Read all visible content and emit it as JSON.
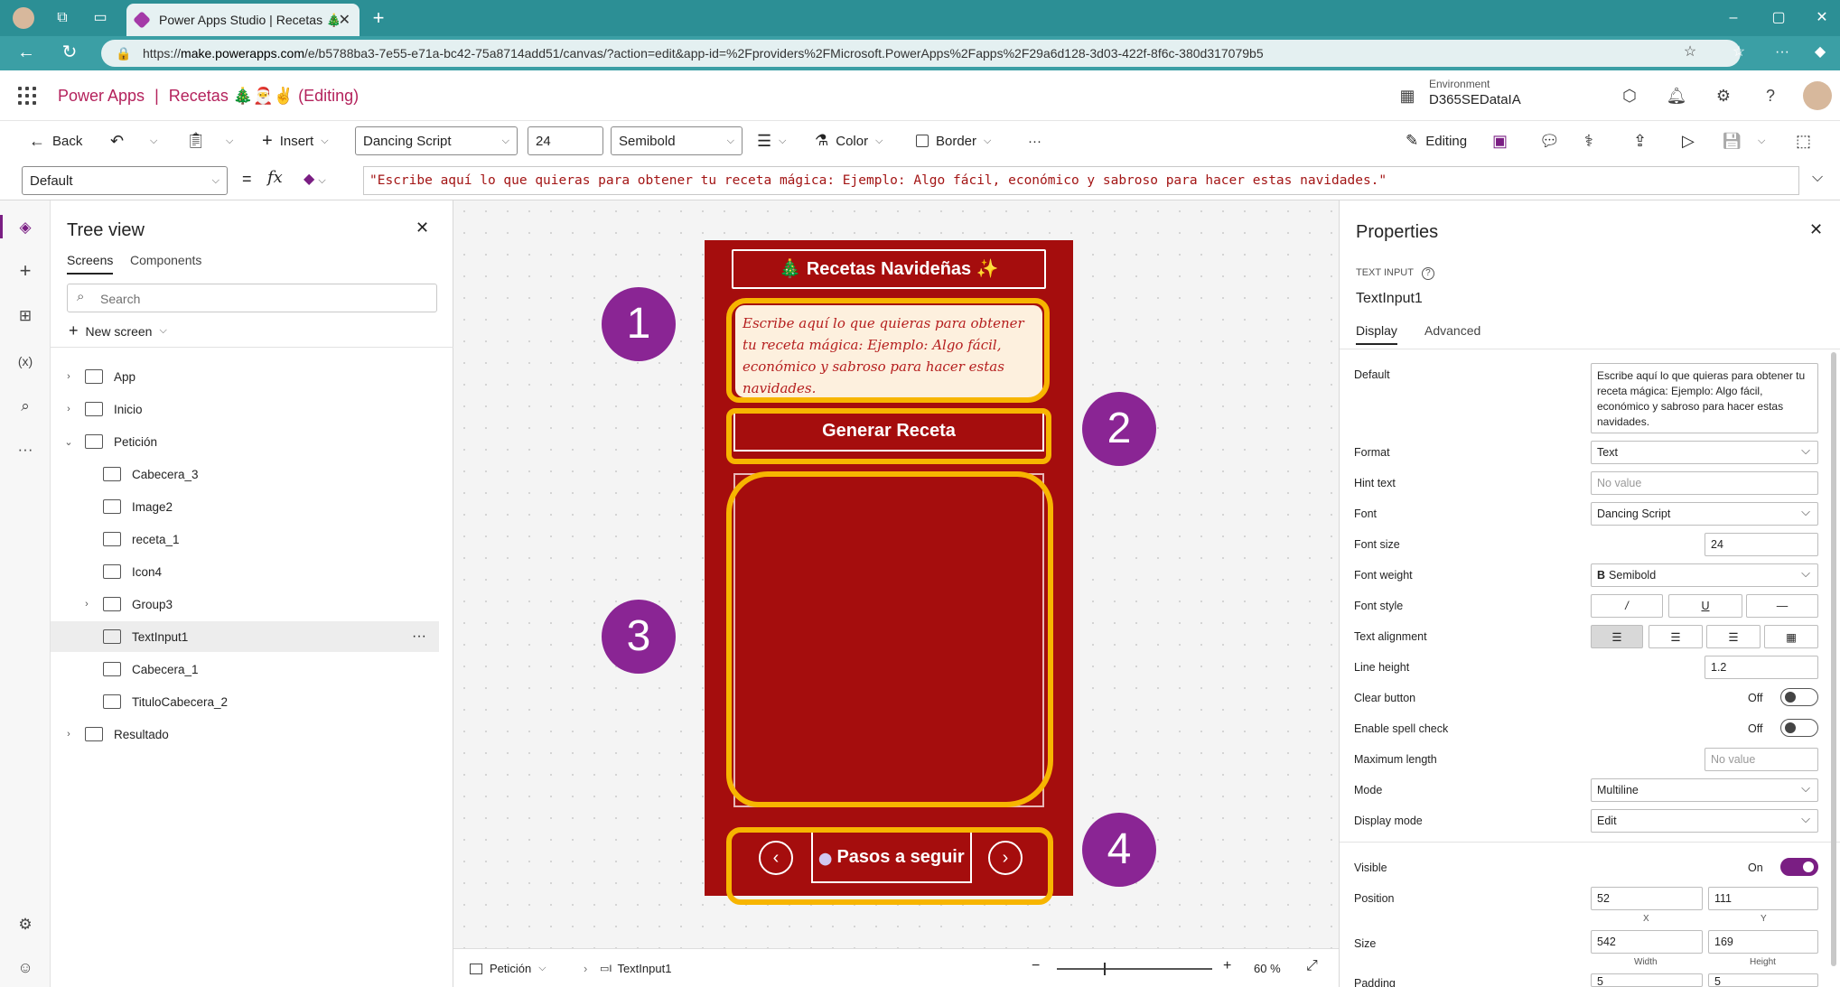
{
  "browser": {
    "tab_title": "Power Apps Studio | Recetas 🎄",
    "url_prefix": "https://",
    "url_host": "make.powerapps.com",
    "url_path": "/e/b5788ba3-7e55-e71a-bc42-75a8714add51/canvas/?action=edit&app-id=%2Fproviders%2FMicrosoft.PowerApps%2Fapps%2F29a6d128-3d03-422f-8f6c-380d317079b5"
  },
  "header": {
    "app_name": "Power Apps",
    "separator": "|",
    "app_title": "Recetas 🎄🎅✌",
    "status": "(Editing)",
    "env_label": "Environment",
    "env_value": "D365SEDataIA"
  },
  "toolbar": {
    "back": "Back",
    "insert": "Insert",
    "font": "Dancing Script",
    "font_size": "24",
    "weight": "Semibold",
    "color": "Color",
    "border": "Border",
    "more": "···",
    "editing": "Editing"
  },
  "formula": {
    "property": "Default",
    "fx": "fx",
    "expression": "\"Escribe aquí lo que quieras para obtener tu receta mágica: Ejemplo: Algo fácil, económico y sabroso para hacer estas navidades.\""
  },
  "tree": {
    "title": "Tree view",
    "tabs": [
      "Screens",
      "Components"
    ],
    "search_placeholder": "Search",
    "new_screen": "New screen",
    "items": [
      {
        "label": "App",
        "level": 0,
        "caret": "›"
      },
      {
        "label": "Inicio",
        "level": 0,
        "caret": "›"
      },
      {
        "label": "Petición",
        "level": 0,
        "caret": "⌄"
      },
      {
        "label": "Cabecera_3",
        "level": 1,
        "caret": ""
      },
      {
        "label": "Image2",
        "level": 1,
        "caret": ""
      },
      {
        "label": "receta_1",
        "level": 1,
        "caret": ""
      },
      {
        "label": "Icon4",
        "level": 1,
        "caret": ""
      },
      {
        "label": "Group3",
        "level": 1,
        "caret": "›"
      },
      {
        "label": "TextInput1",
        "level": 1,
        "caret": "",
        "selected": true
      },
      {
        "label": "Cabecera_1",
        "level": 1,
        "caret": ""
      },
      {
        "label": "TituloCabecera_2",
        "level": 1,
        "caret": ""
      },
      {
        "label": "Resultado",
        "level": 0,
        "caret": "›"
      }
    ],
    "item_more": "···"
  },
  "canvas": {
    "header_title": "🎄 Recetas Navideñas ✨",
    "input_text": "Escribe aquí lo que quieras para obtener tu receta mágica: Ejemplo: Algo fácil, económico y sabroso para hacer estas navidades.",
    "generate_button": "Generar Receta",
    "steps_button": "Pasos a seguir",
    "badges": [
      "1",
      "2",
      "3",
      "4"
    ]
  },
  "bottombar": {
    "screen": "Petición",
    "control": "TextInput1",
    "zoom": "60",
    "zoom_unit": "%"
  },
  "properties": {
    "title": "Properties",
    "type_label": "TEXT INPUT",
    "control_name": "TextInput1",
    "tabs": [
      "Display",
      "Advanced"
    ],
    "default_label": "Default",
    "default_value": "Escribe aquí lo que quieras para obtener tu receta mágica: Ejemplo: Algo fácil, económico y sabroso para hacer estas navidades.",
    "format_label": "Format",
    "format_value": "Text",
    "hint_label": "Hint text",
    "hint_value": "No value",
    "font_label": "Font",
    "font_value": "Dancing Script",
    "size_label": "Font size",
    "size_value": "24",
    "weight_label": "Font weight",
    "weight_value": "Semibold",
    "style_label": "Font style",
    "style_buttons": [
      "/",
      "U",
      "—"
    ],
    "align_label": "Text alignment",
    "lineheight_label": "Line height",
    "lineheight_value": "1.2",
    "clear_label": "Clear button",
    "clear_value": "Off",
    "spell_label": "Enable spell check",
    "spell_value": "Off",
    "maxlen_label": "Maximum length",
    "maxlen_value": "No value",
    "mode_label": "Mode",
    "mode_value": "Multiline",
    "dmode_label": "Display mode",
    "dmode_value": "Edit",
    "visible_label": "Visible",
    "visible_value": "On",
    "position_label": "Position",
    "pos_x": "52",
    "pos_y": "111",
    "x_label": "X",
    "y_label": "Y",
    "size2_label": "Size",
    "width": "542",
    "height": "169",
    "w_label": "Width",
    "h_label": "Height",
    "padding_label": "Padding",
    "pad1": "5",
    "pad2": "5"
  },
  "colors": {
    "tabbar": "#2c8f95",
    "brand": "#b4225c",
    "phone": "#a50d0d",
    "highlight": "#f7b500",
    "badge": "#8a2594"
  }
}
